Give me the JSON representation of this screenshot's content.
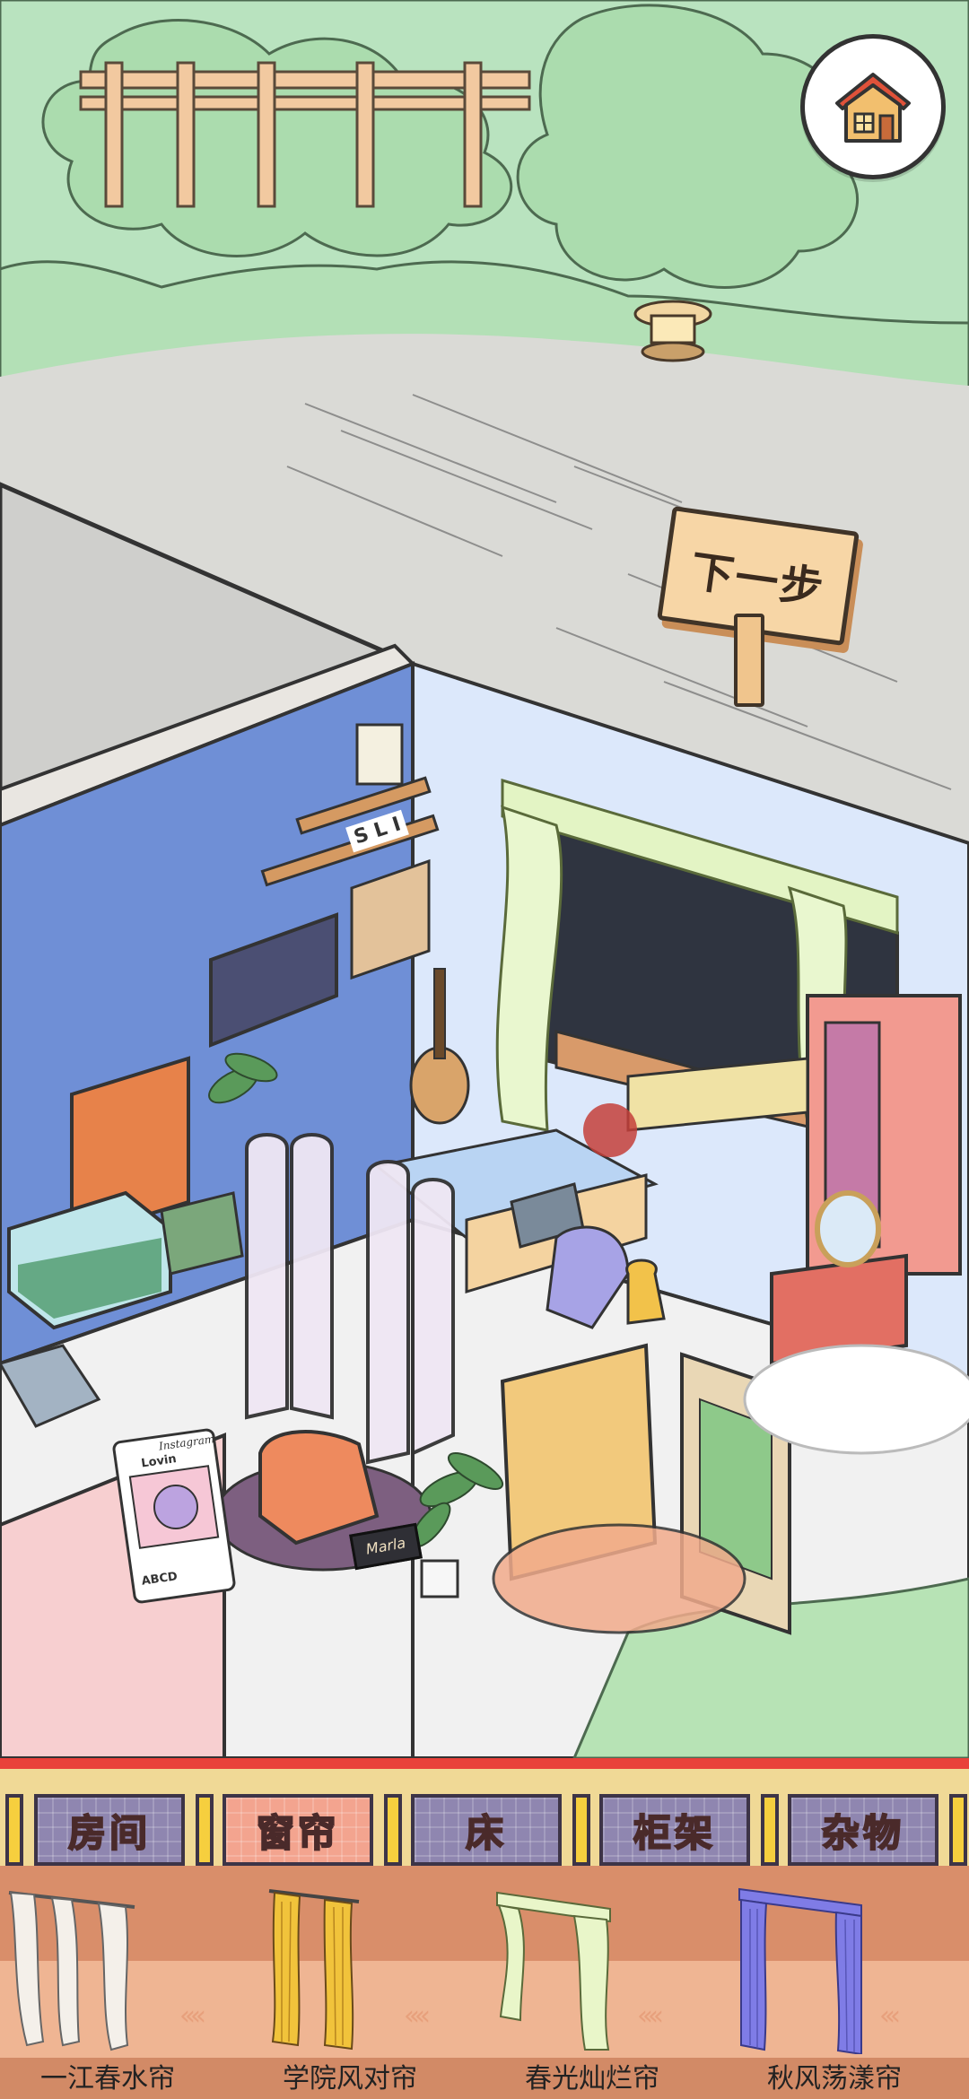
{
  "scene": {
    "next_sign_text": "下一步",
    "photo_card": {
      "username": "Lovin",
      "caption": "ABCD",
      "header": "Instagram"
    },
    "speaker_label": "Marla",
    "wall_letters": "S L I"
  },
  "tabs": [
    {
      "label": "房间",
      "active": false
    },
    {
      "label": "窗帘",
      "active": true
    },
    {
      "label": "床",
      "active": false
    },
    {
      "label": "柜架",
      "active": false
    },
    {
      "label": "杂物",
      "active": false
    }
  ],
  "items": [
    {
      "label": "一江春水帘",
      "icon": "white-sheer-curtain-icon",
      "color": "#f4f0ea"
    },
    {
      "label": "学院风对帘",
      "icon": "yellow-curtain-icon",
      "color": "#f1c33b"
    },
    {
      "label": "春光灿烂帘",
      "icon": "green-floral-curtain-icon",
      "color": "#e9f6c9"
    },
    {
      "label": "秋风荡漾帘",
      "icon": "blue-curtain-icon",
      "color": "#7f7ce6"
    }
  ],
  "colors": {
    "accent_red": "#e9413a",
    "tab_purple": "#8f86b0",
    "tab_active": "#f3a48f",
    "panel_yellow": "#f0d996"
  }
}
